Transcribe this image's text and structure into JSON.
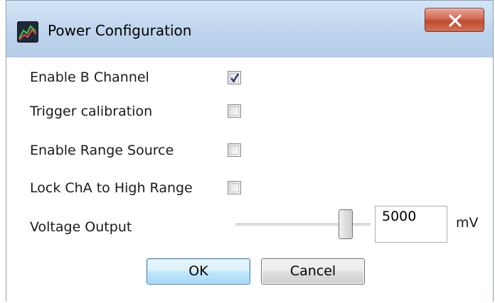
{
  "window": {
    "title": "Power Configuration",
    "close_label": "x"
  },
  "options": [
    {
      "label": "Enable B Channel",
      "checked": true
    },
    {
      "label": "Trigger calibration",
      "checked": false
    },
    {
      "label": "Enable Range Source",
      "checked": false
    },
    {
      "label": "Lock ChA to High Range",
      "checked": false
    }
  ],
  "voltage": {
    "label": "Voltage Output",
    "value": "5000",
    "unit": "mV",
    "slider_fraction": 0.85
  },
  "buttons": {
    "ok": "OK",
    "cancel": "Cancel"
  },
  "colors": {
    "accent": "#3c7fb1",
    "check": "#2b3d7a",
    "close": "#c04a30"
  }
}
